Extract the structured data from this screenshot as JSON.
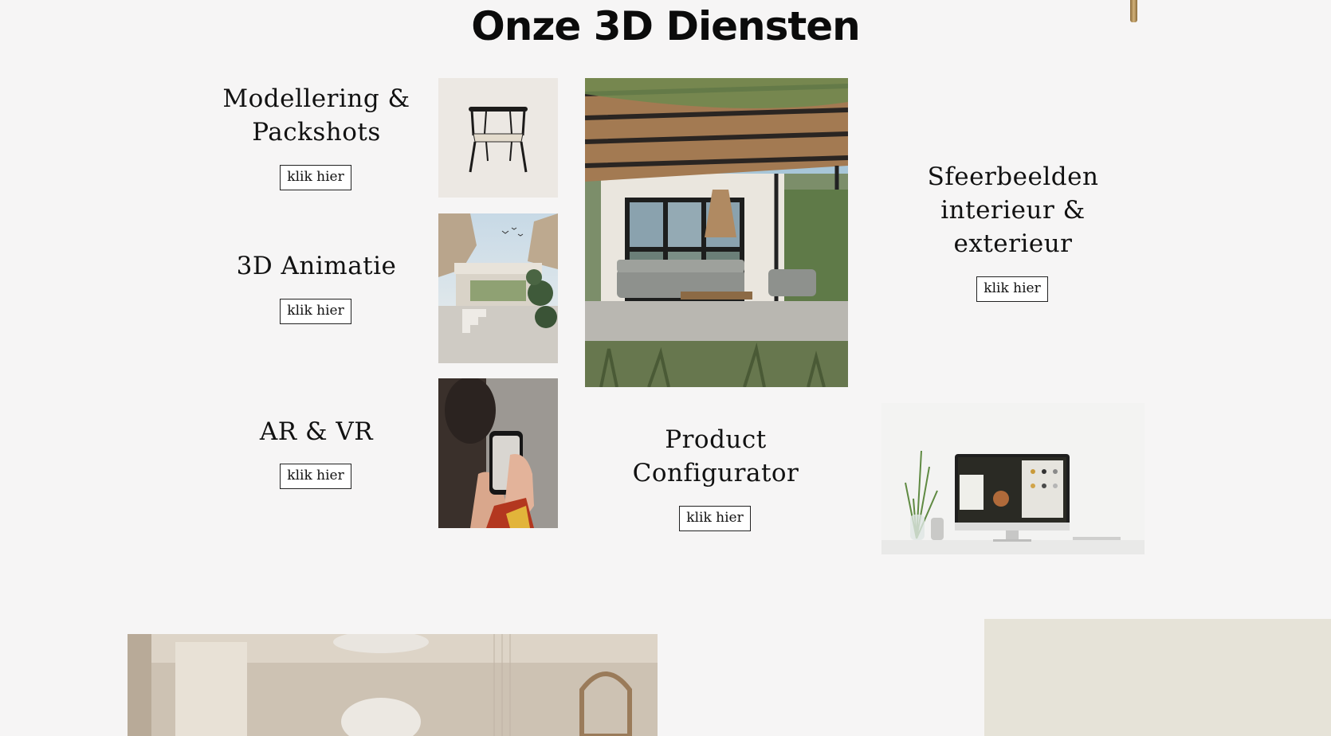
{
  "page": {
    "title": "Onze 3D Diensten"
  },
  "services": [
    {
      "title_lines": [
        "Modellering &",
        "Packshots"
      ],
      "button": "klik hier"
    },
    {
      "title_lines": [
        "3D Animatie"
      ],
      "button": "klik hier"
    },
    {
      "title_lines": [
        "AR & VR"
      ],
      "button": "klik hier"
    },
    {
      "title_lines": [
        "Product",
        "Configurator"
      ],
      "button": "klik hier"
    },
    {
      "title_lines": [
        "Sfeerbeelden",
        "interieur &",
        "exterieur"
      ],
      "button": "klik hier"
    }
  ],
  "images": {
    "chair": "chair-packshot-image",
    "animation": "3d-animation-architecture-image",
    "ar": "hand-holding-phone-ar-image",
    "pergola": "pergola-terrace-rendering-image",
    "configurator": "desktop-configurator-screen-image",
    "interior": "interior-chandelier-rendering-image"
  },
  "colors": {
    "background": "#f6f5f5",
    "beige_panel": "#e6e3d8",
    "text": "#111111"
  }
}
